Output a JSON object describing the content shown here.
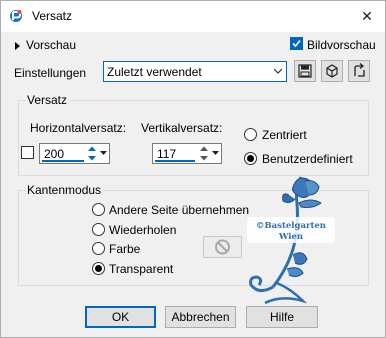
{
  "window": {
    "title": "Versatz",
    "close_glyph": "✕",
    "icon": "app-logo-icon"
  },
  "preview": {
    "toggle_label": "Vorschau",
    "checkbox_label": "Bildvorschau",
    "checked": true
  },
  "settings": {
    "label": "Einstellungen",
    "value": "Zuletzt verwendet",
    "icons": [
      "save-icon",
      "manage-presets-icon",
      "reset-icon"
    ]
  },
  "offset_group": {
    "title": "Versatz",
    "horizontal_label": "Horizontalversatz:",
    "horizontal_value": "200",
    "vertical_label": "Vertikalversatz:",
    "vertical_value": "117",
    "centered_label": "Zentriert",
    "custom_label": "Benutzerdefiniert",
    "selected": "custom"
  },
  "edge_group": {
    "title": "Kantenmodus",
    "options": [
      "Andere Seite übernehmen",
      "Wiederholen",
      "Farbe",
      "Transparent"
    ],
    "selected": "Transparent"
  },
  "watermark": {
    "line1": "©Bastelgarten",
    "line2": "Wien"
  },
  "buttons": {
    "ok": "OK",
    "cancel": "Abbrechen",
    "help": "Hilfe"
  },
  "colors": {
    "accent": "#0067c0",
    "flower": "#2f6fb0"
  }
}
